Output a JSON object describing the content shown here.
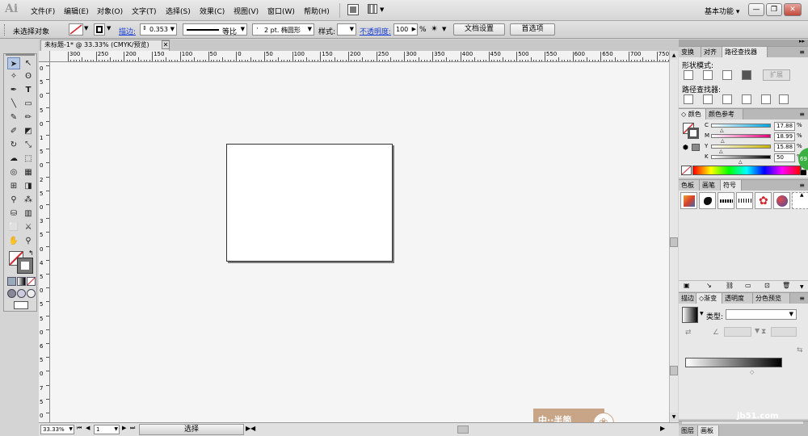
{
  "app": {
    "logo": "Ai",
    "workspace": "基本功能 ▾"
  },
  "menu": [
    "文件(F)",
    "编辑(E)",
    "对象(O)",
    "文字(T)",
    "选择(S)",
    "效果(C)",
    "视图(V)",
    "窗口(W)",
    "帮助(H)"
  ],
  "window_buttons": [
    "—",
    "❐",
    "✕"
  ],
  "control_bar": {
    "selection": "未选择对象",
    "stroke_label": "描边:",
    "stroke_value": "0.353",
    "profile": "等比",
    "brush": "2 pt. 椭圆形",
    "style_label": "样式:",
    "opacity_label": "不透明度:",
    "opacity_value": "100",
    "opacity_unit": "%",
    "doc_setup": "文档设置",
    "preferences": "首选项"
  },
  "document": {
    "tab_title": "未标题-1* @ 33.33% (CMYK/预览)",
    "tab_close": "✕"
  },
  "rulers": {
    "h_ticks": [
      "300",
      "250",
      "200",
      "150",
      "100",
      "50",
      "0",
      "50",
      "100",
      "150",
      "200",
      "250",
      "300",
      "350",
      "400",
      "450",
      "500",
      "550",
      "600",
      "650",
      "700",
      "750"
    ],
    "v_ticks": [
      "0",
      "5",
      "0",
      "5",
      "0",
      "1",
      "5",
      "0",
      "2",
      "5",
      "0",
      "3",
      "5",
      "0",
      "4",
      "5",
      "0",
      "5",
      "5",
      "0",
      "6",
      "5",
      "0",
      "7",
      "5",
      "0"
    ]
  },
  "status": {
    "zoom": "33.33%",
    "page": "1",
    "tool": "选择"
  },
  "panels": {
    "pathfinder": {
      "tabs": [
        "变换",
        "对齐",
        "路径查找器"
      ],
      "shape_modes": "形状模式:",
      "expand": "扩展",
      "pathfinders": "路径查找器:"
    },
    "color": {
      "tabs": [
        "颜色",
        "颜色参考"
      ],
      "channels": [
        {
          "name": "C",
          "value": "17.88",
          "unit": "%",
          "fraction": 0.18
        },
        {
          "name": "M",
          "value": "18.99",
          "unit": "%",
          "fraction": 0.19
        },
        {
          "name": "Y",
          "value": "15.88",
          "unit": "%",
          "fraction": 0.16
        },
        {
          "name": "K",
          "value": "50",
          "unit": "%",
          "fraction": 0.5
        }
      ]
    },
    "symbols": {
      "tabs": [
        "色板",
        "画笔",
        "符号"
      ]
    },
    "gradient": {
      "tabs": [
        "描边",
        "渐变",
        "透明度",
        "分色预览"
      ],
      "type_label": "类型:"
    },
    "bottom_tabs": [
      "图层",
      "画板"
    ]
  },
  "watermark": {
    "badge": "中··半简",
    "site": "jb51.com"
  },
  "colors": {
    "accent_red": "#d8232a",
    "link_blue": "#1a3fd6"
  }
}
